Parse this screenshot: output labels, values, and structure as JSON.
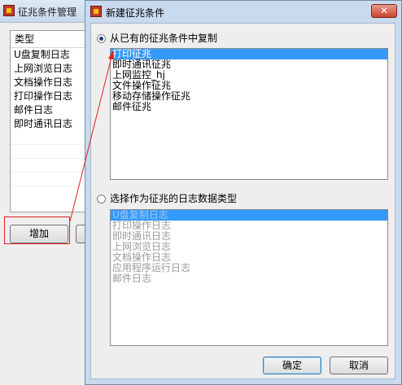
{
  "background_window": {
    "title": "征兆条件管理",
    "list_header": "类型",
    "rows": [
      "U盘复制日志",
      "上网浏览日志",
      "文档操作日志",
      "打印操作日志",
      "邮件日志",
      "即时通讯日志"
    ],
    "add_button": "增加"
  },
  "dialog": {
    "title": "新建征兆条件",
    "close_glyph": "✕",
    "option_copy": {
      "label": "从已有的征兆条件中复制",
      "checked": true,
      "items": [
        "打印征兆",
        "即时通讯征兆",
        "上网监控_hj",
        "文件操作征兆",
        "移动存储操作征兆",
        "邮件征兆"
      ],
      "selected_index": 0
    },
    "option_log_type": {
      "label": "选择作为征兆的日志数据类型",
      "checked": false,
      "items": [
        "U盘复制日志",
        "打印操作日志",
        "即时通讯日志",
        "上网浏览日志",
        "文档操作日志",
        "应用程序运行日志",
        "邮件日志"
      ],
      "selected_index": 0
    },
    "ok_button": "确定",
    "cancel_button": "取消"
  },
  "colors": {
    "selection": "#3399ff",
    "annotation": "#e02020",
    "close_button": "#c8452f"
  }
}
